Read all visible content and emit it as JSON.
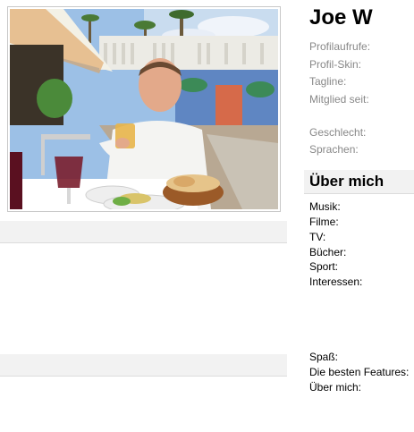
{
  "profile": {
    "name": "Joe W"
  },
  "meta": {
    "views_label": "Profilaufrufe:",
    "skin_label": "Profil-Skin:",
    "tagline_label": "Tagline:",
    "member_since_label": "Mitglied seit:",
    "gender_label": "Geschlecht:",
    "languages_label": "Sprachen:"
  },
  "about": {
    "title": "Über mich",
    "music_label": "Musik:",
    "films_label": "Filme:",
    "tv_label": "TV:",
    "books_label": "Bücher:",
    "sport_label": "Sport:",
    "interests_label": "Interessen:",
    "fun_label": "Spaß:",
    "best_features_label": "Die besten Features:",
    "about_me_label": "Über mich:"
  },
  "colors": {
    "label_grey": "#888888",
    "bar_grey": "#f2f2f2",
    "border_grey": "#dcdcdc"
  }
}
